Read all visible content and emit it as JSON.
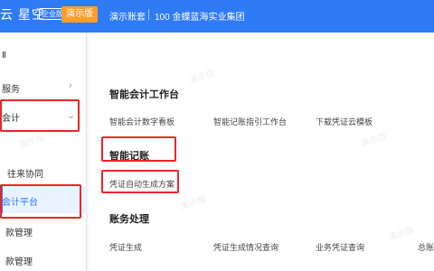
{
  "header": {
    "brand": "云 星空",
    "edition": "企业版",
    "demo_badge": "演示版",
    "account": "演示账套",
    "org": "100 金蝶蓝海实业集团"
  },
  "sidebar": {
    "items": [
      {
        "label": "Ⅱ"
      },
      {
        "label": "服务"
      },
      {
        "label": "会计"
      },
      {
        "label": "往来协同"
      },
      {
        "label": "会计平台"
      },
      {
        "label": "款管理"
      },
      {
        "label": "款管理"
      }
    ]
  },
  "main": {
    "sections": [
      {
        "title": "智能会计工作台",
        "links": [
          "智能会计数字看板",
          "智能记账指引工作台",
          "下载凭证云模板"
        ]
      },
      {
        "title": "智能记账",
        "links": [
          "凭证自动生成方案"
        ]
      },
      {
        "title": "账务处理",
        "links": [
          "凭证生成",
          "凭证生成情况查询",
          "业务凭证查询",
          "总账"
        ]
      }
    ]
  },
  "watermark": "演示版",
  "colors": {
    "primary": "#2f7bf5",
    "highlight": "#e8262c",
    "badge": "#ff9e2c"
  }
}
